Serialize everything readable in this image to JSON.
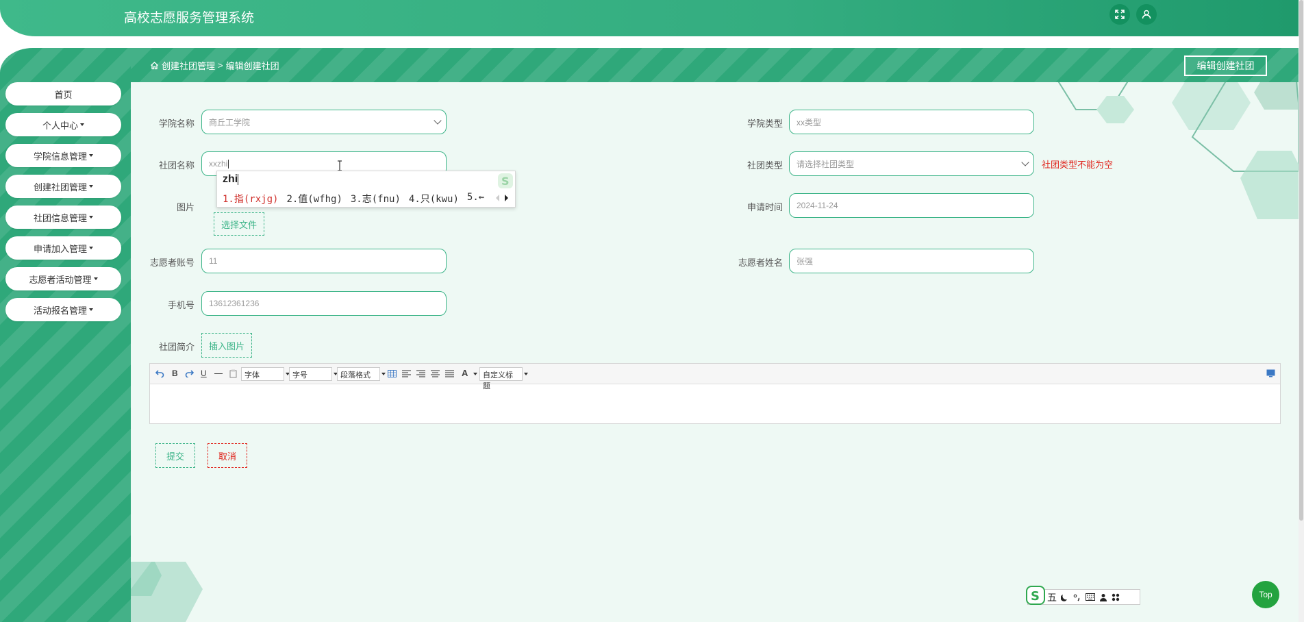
{
  "header": {
    "title": "高校志愿服务管理系统"
  },
  "sidebar": {
    "items": [
      {
        "label": "首页",
        "has_dropdown": false
      },
      {
        "label": "个人中心",
        "has_dropdown": true
      },
      {
        "label": "学院信息管理",
        "has_dropdown": true
      },
      {
        "label": "创建社团管理",
        "has_dropdown": true
      },
      {
        "label": "社团信息管理",
        "has_dropdown": true
      },
      {
        "label": "申请加入管理",
        "has_dropdown": true
      },
      {
        "label": "志愿者活动管理",
        "has_dropdown": true
      },
      {
        "label": "活动报名管理",
        "has_dropdown": true
      }
    ]
  },
  "breadcrumb": {
    "parent": "创建社团管理",
    "separator": ">",
    "current": "编辑创建社团"
  },
  "page_action": "编辑创建社团",
  "form": {
    "college_name": {
      "label": "学院名称",
      "value": "商丘工学院"
    },
    "college_type": {
      "label": "学院类型",
      "value": "xx类型"
    },
    "club_name": {
      "label": "社团名称",
      "value": "xxzhi"
    },
    "club_type": {
      "label": "社团类型",
      "placeholder": "请选择社团类型",
      "error": "社团类型不能为空"
    },
    "image": {
      "label": "图片",
      "button": "选择文件"
    },
    "apply_time": {
      "label": "申请时间",
      "value": "2024-11-24"
    },
    "volunteer_account": {
      "label": "志愿者账号",
      "value": "11"
    },
    "volunteer_name": {
      "label": "志愿者姓名",
      "value": "张强"
    },
    "phone": {
      "label": "手机号",
      "value": "13612361236"
    },
    "intro": {
      "label": "社团简介",
      "insert_image": "插入图片"
    }
  },
  "editor": {
    "font_label": "字体",
    "size_label": "字号",
    "paragraph_label": "段落格式",
    "custom_title_label": "自定义标题",
    "color_glyph": "A",
    "bold_glyph": "B",
    "underline_glyph": "U"
  },
  "buttons": {
    "submit": "提交",
    "cancel": "取消"
  },
  "ime": {
    "composition": "zhi",
    "candidates": [
      "1.指(rxjg)",
      "2.值(wfhg)",
      "3.志(fnu)",
      "4.只(kwu)",
      "5.⇜"
    ],
    "status_mode": "五"
  },
  "top_button": "Top",
  "colors": {
    "primary": "#3cb488",
    "header": "#34ad80",
    "error": "#e0271f",
    "top_button": "#23a33f"
  }
}
